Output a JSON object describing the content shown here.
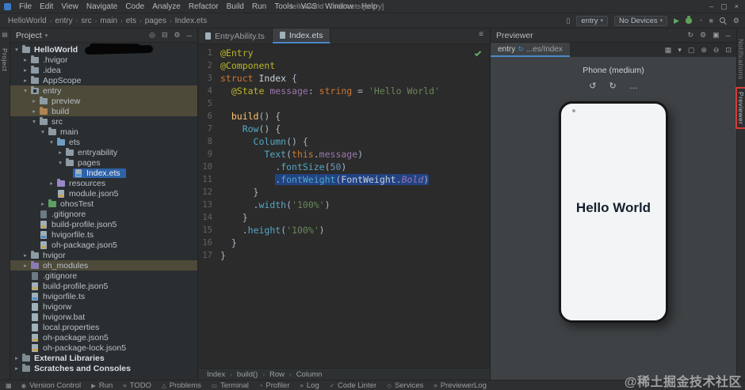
{
  "titlebar": {
    "menu": [
      "File",
      "Edit",
      "View",
      "Navigate",
      "Code",
      "Analyze",
      "Refactor",
      "Build",
      "Run",
      "Tools",
      "VCS",
      "Window",
      "Help"
    ],
    "title": "HelloWorld - Index.ets [entry]"
  },
  "toolbar": {
    "breadcrumbs": [
      "HelloWorld",
      "entry",
      "src",
      "main",
      "ets",
      "pages",
      "Index.ets"
    ],
    "run_config": "entry",
    "device": "No Devices"
  },
  "left_strip": {
    "tab": "Project"
  },
  "right_strip": {
    "tabs": [
      "Notifications",
      "Previewer"
    ]
  },
  "project": {
    "title": "Project",
    "header_icons": [
      "locate-file-icon",
      "collapse-all-icon",
      "settings-icon",
      "hide-icon"
    ],
    "tree": [
      {
        "label": "HelloWorld",
        "depth": 0,
        "icon": "folder",
        "chev": "open",
        "redacted": true
      },
      {
        "label": ".hvigor",
        "depth": 1,
        "icon": "folder",
        "chev": "closed"
      },
      {
        "label": ".idea",
        "depth": 1,
        "icon": "folder",
        "chev": "closed"
      },
      {
        "label": "AppScope",
        "depth": 1,
        "icon": "folder",
        "chev": "closed"
      },
      {
        "label": "entry",
        "depth": 1,
        "icon": "module",
        "chev": "open",
        "state": "hl"
      },
      {
        "label": "preview",
        "depth": 2,
        "icon": "folder",
        "chev": "closed",
        "state": "hl"
      },
      {
        "label": "build",
        "depth": 2,
        "icon": "folder-excluded",
        "chev": "closed",
        "state": "hl"
      },
      {
        "label": "src",
        "depth": 2,
        "icon": "folder",
        "chev": "open"
      },
      {
        "label": "main",
        "depth": 3,
        "icon": "folder",
        "chev": "open"
      },
      {
        "label": "ets",
        "depth": 4,
        "icon": "folder-src",
        "chev": "open"
      },
      {
        "label": "entryability",
        "depth": 5,
        "icon": "folder",
        "chev": "closed"
      },
      {
        "label": "pages",
        "depth": 5,
        "icon": "folder",
        "chev": "open"
      },
      {
        "label": "Index.ets",
        "depth": 6,
        "icon": "file-ets",
        "chev": "none",
        "state": "sel"
      },
      {
        "label": "resources",
        "depth": 4,
        "icon": "folder-res",
        "chev": "closed"
      },
      {
        "label": "module.json5",
        "depth": 4,
        "icon": "file-json",
        "chev": "none"
      },
      {
        "label": "ohosTest",
        "depth": 3,
        "icon": "folder-test",
        "chev": "closed"
      },
      {
        "label": ".gitignore",
        "depth": 2,
        "icon": "file-git",
        "chev": "none"
      },
      {
        "label": "build-profile.json5",
        "depth": 2,
        "icon": "file-json",
        "chev": "none"
      },
      {
        "label": "hvigorfile.ts",
        "depth": 2,
        "icon": "file-ts",
        "chev": "none"
      },
      {
        "label": "oh-package.json5",
        "depth": 2,
        "icon": "file-json",
        "chev": "none"
      },
      {
        "label": "hvigor",
        "depth": 1,
        "icon": "folder",
        "chev": "closed"
      },
      {
        "label": "oh_modules",
        "depth": 1,
        "icon": "folder-lib",
        "chev": "closed",
        "state": "hl"
      },
      {
        "label": ".gitignore",
        "depth": 1,
        "icon": "file-git",
        "chev": "none"
      },
      {
        "label": "build-profile.json5",
        "depth": 1,
        "icon": "file-json",
        "chev": "none"
      },
      {
        "label": "hvigorfile.ts",
        "depth": 1,
        "icon": "file-ts",
        "chev": "none"
      },
      {
        "label": "hvigorw",
        "depth": 1,
        "icon": "file",
        "chev": "none"
      },
      {
        "label": "hvigorw.bat",
        "depth": 1,
        "icon": "file",
        "chev": "none"
      },
      {
        "label": "local.properties",
        "depth": 1,
        "icon": "file",
        "chev": "none"
      },
      {
        "label": "oh-package.json5",
        "depth": 1,
        "icon": "file-json",
        "chev": "none"
      },
      {
        "label": "oh-package-lock.json5",
        "depth": 1,
        "icon": "file-json",
        "chev": "none"
      },
      {
        "label": "External Libraries",
        "depth": 0,
        "icon": "lib",
        "chev": "closed"
      },
      {
        "label": "Scratches and Consoles",
        "depth": 0,
        "icon": "scratch",
        "chev": "closed"
      }
    ]
  },
  "editor": {
    "tabs": [
      {
        "label": "EntryAbility.ts",
        "active": false
      },
      {
        "label": "Index.ets",
        "active": true
      }
    ],
    "breadcrumb": [
      "Index",
      "build()",
      "Row",
      "Column"
    ],
    "lines": [
      {
        "tokens": [
          [
            "ann",
            "@Entry"
          ]
        ]
      },
      {
        "tokens": [
          [
            "ann",
            "@Component"
          ]
        ]
      },
      {
        "tokens": [
          [
            "kw",
            "struct"
          ],
          [
            "pl",
            " "
          ],
          [
            "cls",
            "Index"
          ],
          [
            "pl",
            " {"
          ]
        ]
      },
      {
        "tokens": [
          [
            "pl",
            "  "
          ],
          [
            "ann",
            "@State"
          ],
          [
            "pl",
            " "
          ],
          [
            "fld",
            "message"
          ],
          [
            "pl",
            ": "
          ],
          [
            "kw",
            "string"
          ],
          [
            "pl",
            " = "
          ],
          [
            "str",
            "'Hello World'"
          ]
        ]
      },
      {
        "tokens": []
      },
      {
        "tokens": [
          [
            "pl",
            "  "
          ],
          [
            "fn",
            "build"
          ],
          [
            "pl",
            "() {"
          ]
        ]
      },
      {
        "tokens": [
          [
            "pl",
            "    "
          ],
          [
            "cmp",
            "Row"
          ],
          [
            "pl",
            "() {"
          ]
        ]
      },
      {
        "tokens": [
          [
            "pl",
            "      "
          ],
          [
            "cmp",
            "Column"
          ],
          [
            "pl",
            "() {"
          ]
        ]
      },
      {
        "tokens": [
          [
            "pl",
            "        "
          ],
          [
            "cmp",
            "Text"
          ],
          [
            "pl",
            "("
          ],
          [
            "kw",
            "this"
          ],
          [
            "pl",
            "."
          ],
          [
            "fld",
            "message"
          ],
          [
            "pl",
            ")"
          ]
        ]
      },
      {
        "tokens": [
          [
            "pl",
            "          "
          ],
          [
            "pl",
            "."
          ],
          [
            "mth",
            "fontSize"
          ],
          [
            "pl",
            "("
          ],
          [
            "num",
            "50"
          ],
          [
            "pl",
            ")"
          ]
        ]
      },
      {
        "tokens": [
          [
            "pl",
            "          "
          ],
          [
            "pl",
            "."
          ],
          [
            "mth",
            "fontWeight"
          ],
          [
            "pl",
            "("
          ],
          [
            "cls",
            "FontWeight"
          ],
          [
            "pl",
            "."
          ],
          [
            "enum",
            "Bold"
          ],
          [
            "pl",
            ")"
          ]
        ],
        "sel_from": 1
      },
      {
        "tokens": [
          [
            "pl",
            "      }"
          ]
        ]
      },
      {
        "tokens": [
          [
            "pl",
            "      "
          ],
          [
            "pl",
            "."
          ],
          [
            "mth",
            "width"
          ],
          [
            "pl",
            "("
          ],
          [
            "str",
            "'100%'"
          ],
          [
            "pl",
            ")"
          ]
        ]
      },
      {
        "tokens": [
          [
            "pl",
            "    }"
          ]
        ]
      },
      {
        "tokens": [
          [
            "pl",
            "    "
          ],
          [
            "pl",
            "."
          ],
          [
            "mth",
            "height"
          ],
          [
            "pl",
            "("
          ],
          [
            "str",
            "'100%'"
          ],
          [
            "pl",
            ")"
          ]
        ]
      },
      {
        "tokens": [
          [
            "pl",
            "  }"
          ]
        ]
      },
      {
        "tokens": [
          [
            "pl",
            "}"
          ]
        ]
      }
    ]
  },
  "previewer": {
    "title": "Previewer",
    "header_icons": [
      "refresh-icon",
      "settings-icon",
      "float-icon",
      "hide-icon"
    ],
    "tab": {
      "module": "entry",
      "path": "...es/Index"
    },
    "tab_icons": [
      "grid-icon",
      "chevron-down-icon",
      "frame-icon",
      "zoom-in-icon",
      "zoom-out-icon",
      "fit-icon"
    ],
    "device_label": "Phone (medium)",
    "device_icons": [
      "rotate-left-icon",
      "rotate-right-icon",
      "more-icon"
    ],
    "screen_text": "Hello World"
  },
  "statusbar": {
    "items": [
      {
        "icon": "version-control-icon",
        "label": "Version Control"
      },
      {
        "icon": "run-icon",
        "label": "Run"
      },
      {
        "icon": "todo-icon",
        "label": "TODO"
      },
      {
        "icon": "problems-icon",
        "label": "Problems"
      },
      {
        "icon": "terminal-icon",
        "label": "Terminal"
      },
      {
        "icon": "profiler-icon",
        "label": "Profiler"
      },
      {
        "icon": "log-icon",
        "label": "Log"
      },
      {
        "icon": "linter-icon",
        "label": "Code Linter"
      },
      {
        "icon": "services-icon",
        "label": "Services"
      },
      {
        "icon": "previewerlog-icon",
        "label": "PreviewerLog"
      }
    ],
    "watermark": "@稀土掘金技术社区"
  },
  "colors": {
    "selection": "#214283",
    "tree_selected": "#2e62a8",
    "highlight_olive": "#4d4a39",
    "run_green": "#5fad65",
    "annotation_red": "#d43b3b",
    "tab_accent": "#4a88c7"
  }
}
